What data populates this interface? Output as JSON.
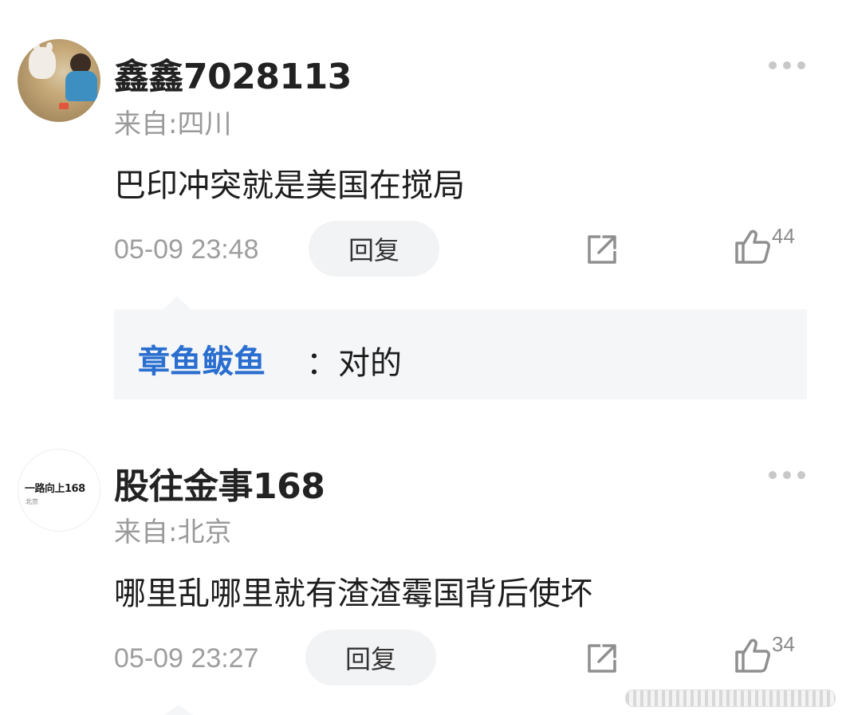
{
  "comments": [
    {
      "username": "鑫鑫7028113",
      "location": "来自:四川",
      "text": "巴印冲突就是美国在搅局",
      "time": "05-09 23:48",
      "reply_label": "回复",
      "likes": "44",
      "avatar_icon": "photo-avatar",
      "sub_reply": {
        "user": "章鱼鲅鱼",
        "text": "：对的"
      }
    },
    {
      "username": "股往金事168",
      "location": "来自:北京",
      "text": "哪里乱哪里就有渣渣霉国背后使坏",
      "time": "05-09 23:27",
      "reply_label": "回复",
      "likes": "34",
      "avatar_logo": {
        "main": "一路向上168",
        "sub": "北京"
      }
    }
  ],
  "colors": {
    "link": "#2a6fd0",
    "muted": "#9a9a9a",
    "bubble": "#f5f6f8"
  },
  "icons": [
    "more-icon",
    "share-icon",
    "thumbs-up-icon"
  ]
}
